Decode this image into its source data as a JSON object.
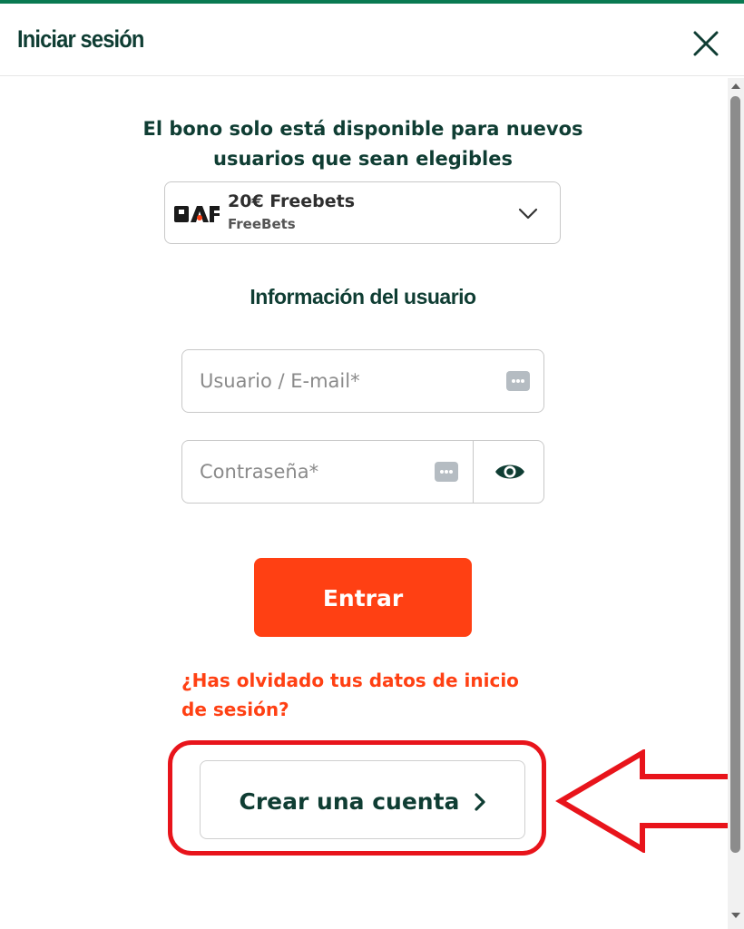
{
  "header": {
    "title": "Iniciar sesión"
  },
  "bonus": {
    "eligibility_text": "El bono solo está disponible para nuevos usuarios que sean elegibles",
    "selected": {
      "logo": "PAF",
      "name": "20€ Freebets",
      "type": "FreeBets"
    }
  },
  "form": {
    "section_title": "Información del usuario",
    "username_placeholder": "Usuario / E-mail*",
    "password_placeholder": "Contraseña*",
    "submit_label": "Entrar",
    "forgot_link": "¿Has olvidado tus datos de inicio de sesión?",
    "create_account_label": "Crear una cuenta"
  },
  "icons": {
    "close": "close-icon",
    "bonus_dropdown": "chevron-down-icon",
    "password_manager": "dots-key-icon",
    "toggle_password": "eye-icon",
    "create_account": "chevron-right-icon",
    "annotation": "arrow-left-icon"
  },
  "colors": {
    "brand_green": "#0a7a52",
    "text_dark": "#0f3d33",
    "accent_orange": "#ff4013",
    "highlight_red": "#e8141b"
  }
}
